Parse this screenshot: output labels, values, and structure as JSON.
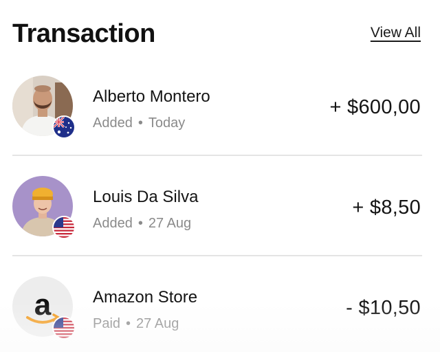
{
  "header": {
    "title": "Transaction",
    "view_all_label": "View All"
  },
  "transactions": [
    {
      "name": "Alberto Montero",
      "status": "Added",
      "separator": "•",
      "date": "Today",
      "amount": "+ $600,00",
      "avatar_icon": "person-photo",
      "flag_icon": "australia-flag-icon"
    },
    {
      "name": "Louis Da Silva",
      "status": "Added",
      "separator": "•",
      "date": "27 Aug",
      "amount": "+ $8,50",
      "avatar_icon": "person-photo",
      "flag_icon": "usa-flag-icon"
    },
    {
      "name": "Amazon Store",
      "status": "Paid",
      "separator": "•",
      "date": "27 Aug",
      "amount": "- $10,50",
      "avatar_icon": "amazon-logo",
      "flag_icon": "usa-flag-icon"
    }
  ],
  "colors": {
    "text_primary": "#141414",
    "text_secondary": "#8a8a8a",
    "divider": "#e4e4e4"
  }
}
